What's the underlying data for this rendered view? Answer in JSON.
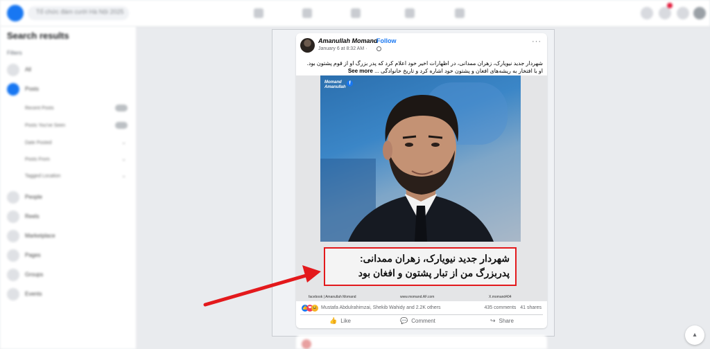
{
  "topbar": {
    "search_placeholder": "Tổ chức đám cưới Hà Nội 2025"
  },
  "sidebar": {
    "title": "Search results",
    "filters_label": "Filters",
    "items": [
      {
        "label": "All",
        "icon": "grid-icon"
      },
      {
        "label": "Posts",
        "icon": "posts-icon",
        "active": true
      }
    ],
    "post_filters": [
      {
        "label": "Recent Posts",
        "control": "toggle"
      },
      {
        "label": "Posts You've Seen",
        "control": "toggle"
      },
      {
        "label": "Date Posted",
        "control": "chevron"
      },
      {
        "label": "Posts From",
        "control": "chevron"
      },
      {
        "label": "Tagged Location",
        "control": "chevron"
      }
    ],
    "more_items": [
      {
        "label": "People",
        "icon": "people-icon"
      },
      {
        "label": "Reels",
        "icon": "reels-icon"
      },
      {
        "label": "Marketplace",
        "icon": "marketplace-icon"
      },
      {
        "label": "Pages",
        "icon": "pages-icon"
      },
      {
        "label": "Groups",
        "icon": "groups-icon"
      },
      {
        "label": "Events",
        "icon": "events-icon"
      }
    ]
  },
  "post": {
    "author": "Amanullah Momand",
    "follow_label": "Follow",
    "separator": "·",
    "date": "January 6 at 8:32 AM ·",
    "more_label": "···",
    "text": "شهردار جدید نیویارک، زهران ممدانی، در اظهارات اخیر خود اعلام کرد که پدر بزرگ او از قوم پشتون بود. او با افتخار به ریشه‌های افغان و پشتون خود اشاره کرد و تاریخ خانوادگی ...",
    "see_more": "See more",
    "image": {
      "watermark_line1": "Momand",
      "watermark_line2": "Amanullah",
      "watermark_badge": "f",
      "caption_line1": "شهردار جدید نیویارک، زهران ممدانی:",
      "caption_line2": "پدربزرگ من از تبار پشتون و افغان بود",
      "footer_left": "facebook | Amanullah Momand",
      "footer_mid": "www.momand.AF.com",
      "footer_right": "X.momand404"
    },
    "reactions": {
      "names": "Mustafa Abdulrahimzai, Shekib Wahidy and 2.2K others",
      "comments": "435 comments",
      "shares": "41 shares",
      "like_glyph": "👍",
      "love_glyph": "❤",
      "haha_glyph": "😆"
    },
    "actions": {
      "like": "Like",
      "comment": "Comment",
      "share": "Share"
    }
  },
  "colors": {
    "facebook_blue": "#1877f2",
    "annotation_red": "#e3191c"
  }
}
